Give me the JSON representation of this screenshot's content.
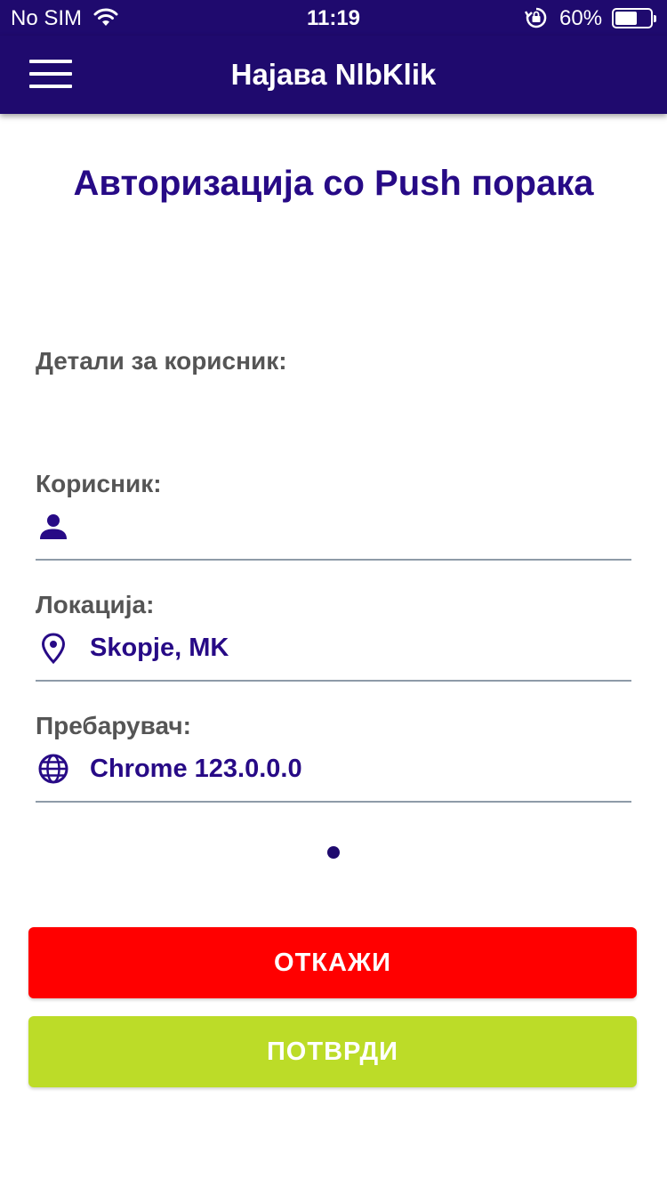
{
  "status_bar": {
    "carrier": "No SIM",
    "time": "11:19",
    "battery_percent": "60%",
    "battery_level": 0.6
  },
  "nav": {
    "title": "Најава NlbKlik"
  },
  "page": {
    "heading": "Авторизација со Push порака",
    "section_label": "Детали за корисник:"
  },
  "fields": {
    "user": {
      "label": "Корисник:",
      "value": "",
      "icon": "person-icon"
    },
    "location": {
      "label": "Локација:",
      "value": "Skopje, MK",
      "icon": "location-pin-icon"
    },
    "browser": {
      "label": "Пребарувач:",
      "value": "Chrome 123.0.0.0",
      "icon": "globe-icon"
    }
  },
  "buttons": {
    "cancel_label": "ОТКАЖИ",
    "confirm_label": "ПОТВРДИ"
  },
  "colors": {
    "brand": "#1f0a6e",
    "accent_text": "#270a86",
    "cancel": "#ff0000",
    "confirm": "#bcdc28"
  }
}
